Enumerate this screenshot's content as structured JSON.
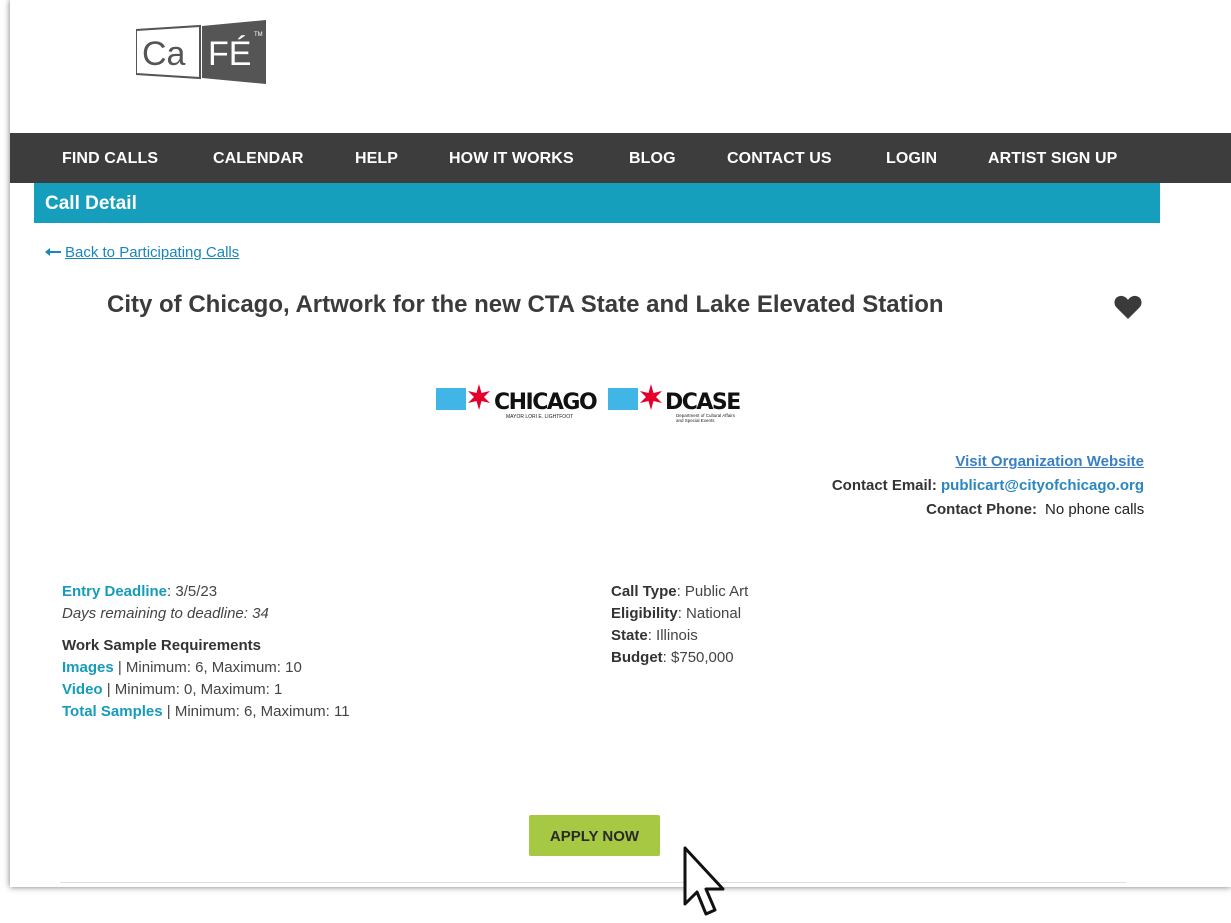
{
  "app": {
    "logo_text": "CaFÉ",
    "brand_color": "#555555"
  },
  "nav": {
    "items": [
      {
        "label": "FIND CALLS"
      },
      {
        "label": "CALENDAR"
      },
      {
        "label": "HELP"
      },
      {
        "label": "HOW IT WORKS"
      },
      {
        "label": "BLOG"
      },
      {
        "label": "CONTACT US"
      },
      {
        "label": "LOGIN"
      },
      {
        "label": "ARTIST SIGN UP"
      }
    ],
    "bg_color": "#3d3d3d"
  },
  "subheader": {
    "title": "Call Detail",
    "color": "#169fbd"
  },
  "back_link": {
    "label": "Back to Participating Calls",
    "icon": "arrow-left-icon"
  },
  "call": {
    "title": "City of Chicago, Artwork for the new CTA State and Lake Elevated Station",
    "favorite_icon": "heart-icon"
  },
  "org_logos": {
    "chicago": {
      "name": "CHICAGO",
      "sub": "MAYOR LORI E. LIGHTFOOT"
    },
    "dcase": {
      "name": "DCASE",
      "sub1": "Department of Cultural Affairs",
      "sub2": "and Special Events"
    }
  },
  "contact": {
    "website_label": "Visit Organization Website",
    "email_label": "Contact Email:",
    "email": "publicart@cityofchicago.org",
    "phone_label": "Contact Phone:",
    "phone": "No phone calls"
  },
  "details_left": {
    "deadline_label": "Entry Deadline",
    "deadline_value": ": 3/5/23",
    "days_remaining": "Days remaining to deadline: 34",
    "requirements_heading": "Work Sample Requirements",
    "requirements": [
      {
        "label": "Images",
        "value": " | Minimum: 6, Maximum: 10"
      },
      {
        "label": "Video",
        "value": " | Minimum: 0, Maximum: 1"
      },
      {
        "label": "Total Samples",
        "value": " | Minimum: 6, Maximum: 11"
      }
    ]
  },
  "details_right": {
    "fields": [
      {
        "label": "Call Type",
        "value": ": Public Art"
      },
      {
        "label": "Eligibility",
        "value": ": National"
      },
      {
        "label": "State",
        "value": ": Illinois"
      },
      {
        "label": "Budget",
        "value": ": $750,000"
      }
    ]
  },
  "actions": {
    "apply_label": "APPLY NOW",
    "apply_color": "#a6c843"
  }
}
